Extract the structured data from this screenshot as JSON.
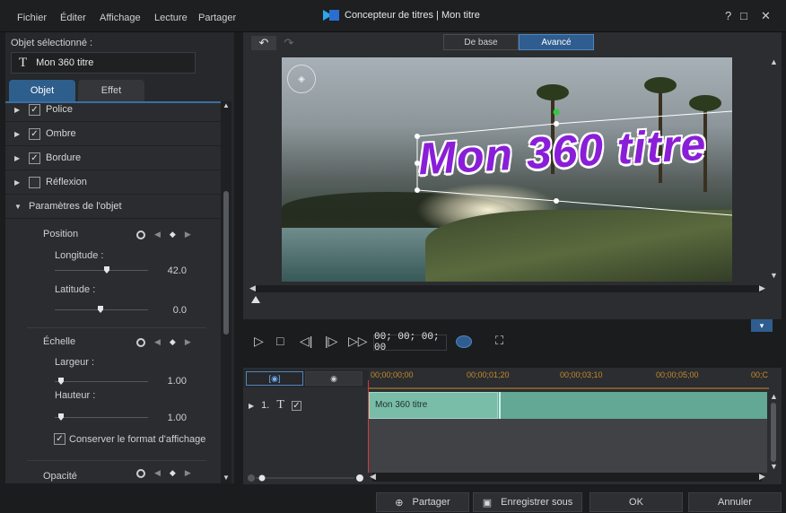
{
  "window": {
    "title": "Concepteur de titres | Mon titre",
    "controls": {
      "help": "?",
      "maximize": "□",
      "close": "✕"
    }
  },
  "menu": [
    "Fichier",
    "Éditer",
    "Affichage",
    "Lecture",
    "Partager"
  ],
  "left_panel": {
    "selected_label": "Objet sélectionné :",
    "selected_value": "Mon 360 titre",
    "selected_icon": "T",
    "tabs": [
      "Objet",
      "Effet"
    ],
    "sections": [
      {
        "label": "Police",
        "checked": true
      },
      {
        "label": "Ombre",
        "checked": true
      },
      {
        "label": "Bordure",
        "checked": true
      },
      {
        "label": "Réflexion",
        "checked": false
      }
    ],
    "object_params": {
      "header": "Paramètres de l'objet",
      "position": {
        "label": "Position",
        "longitude_label": "Longitude :",
        "longitude_value": "42.0",
        "latitude_label": "Latitude :",
        "latitude_value": "0.0"
      },
      "scale": {
        "label": "Échelle",
        "width_label": "Largeur :",
        "width_value": "1.00",
        "height_label": "Hauteur :",
        "height_value": "1.00",
        "keep_ratio_label": "Conserver le format d'affichage",
        "keep_ratio_checked": true
      },
      "opacity_label": "Opacité"
    }
  },
  "preview": {
    "mode_basic": "De base",
    "mode_advanced": "Avancé",
    "overlay_text": "Mon 360 titre",
    "timecode": "00; 00; 00; 00"
  },
  "timeline": {
    "timecodes": [
      "00;00;00;00",
      "00;00;01;20",
      "00;00;03;10",
      "00;00;05;00",
      "00;C"
    ],
    "track_number": "1.",
    "track_icon": "T",
    "clip_label": "Mon 360 titre",
    "clip_color": "#79bda8"
  },
  "buttons": {
    "share": "Partager",
    "save_as": "Enregistrer sous",
    "ok": "OK",
    "cancel": "Annuler"
  },
  "colors": {
    "accent": "#2f5d8f",
    "title_text": "#8a1ed8",
    "playhead": "#d23a3a"
  }
}
